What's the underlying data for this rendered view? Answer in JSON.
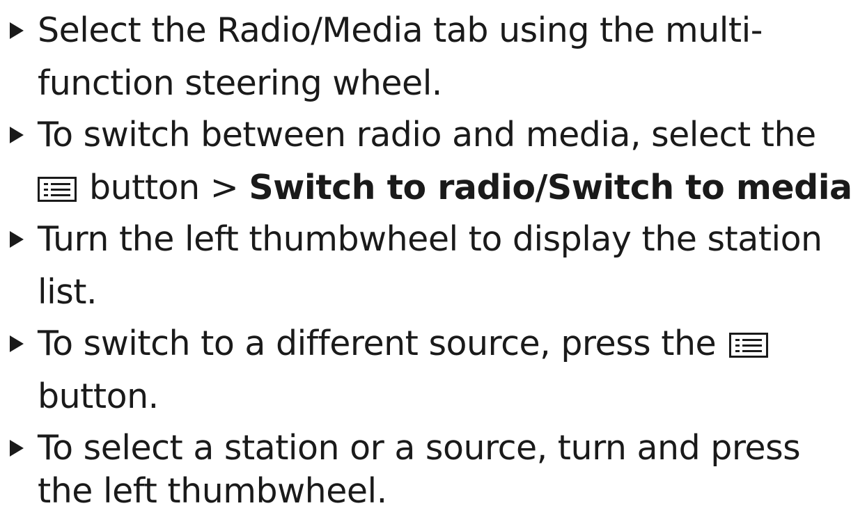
{
  "instructions": {
    "step1": {
      "line1": "Select the Radio/Media tab using the multi-",
      "line2": "function steering wheel."
    },
    "step2": {
      "line1": "To switch between radio and media, select the",
      "button_word": "button >",
      "bold_text": "Switch to radio/Switch to media",
      "end_punctuation": "."
    },
    "step3": {
      "line1": "Turn the left thumbwheel to display the station",
      "line2": "list."
    },
    "step4": {
      "line1": "To switch to a different source, press the",
      "line2": "button."
    },
    "step5": {
      "line1": "To select a station or a source, turn and press",
      "line2": "the left thumbwheel."
    }
  },
  "icons": {
    "bullet": "triangle-right-icon",
    "menu": "list-menu-icon"
  },
  "colors": {
    "text": "#1a1a1a",
    "background": "#ffffff"
  }
}
